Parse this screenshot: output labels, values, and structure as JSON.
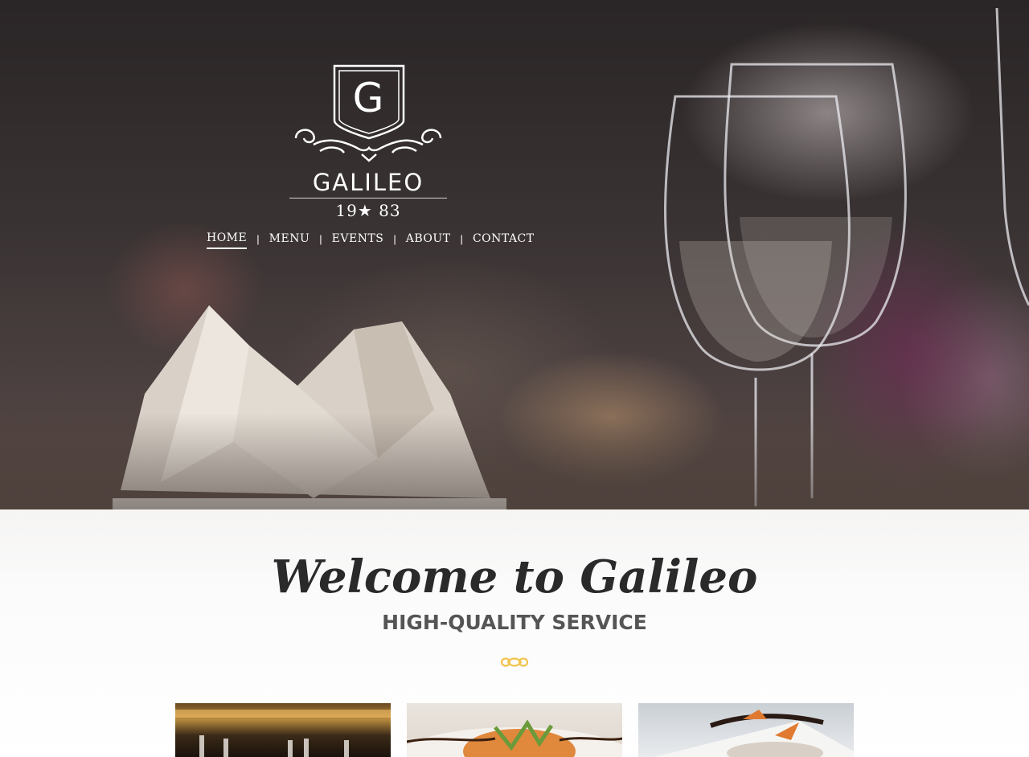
{
  "brand": {
    "monogram": "G",
    "name": "GALILEO",
    "year": "19★ 83"
  },
  "nav": {
    "items": [
      {
        "label": "HOME",
        "active": true
      },
      {
        "label": "MENU"
      },
      {
        "label": "EVENTS"
      },
      {
        "label": "ABOUT"
      },
      {
        "label": "CONTACT"
      }
    ],
    "separator": "|"
  },
  "welcome": {
    "title": "Welcome to Galileo",
    "subtitle": "HIGH-QUALITY SERVICE",
    "ornament_icon": "ornament-icon",
    "accent_color": "#f2c34c"
  },
  "cards": [
    {
      "image": "restaurant-interior-photo"
    },
    {
      "image": "plated-dish-photo"
    },
    {
      "image": "dessert-photo"
    }
  ]
}
